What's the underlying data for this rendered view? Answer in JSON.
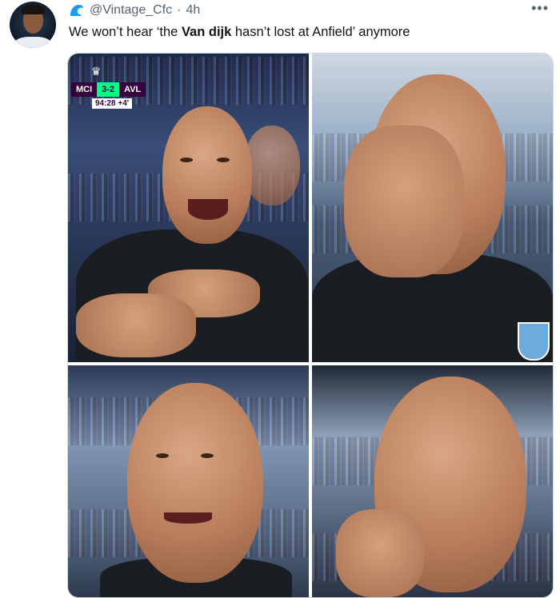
{
  "tweet": {
    "handle": "@Vintage_Cfc",
    "separator": "·",
    "time": "4h",
    "more_icon": "more-icon",
    "text": "We won’t hear ‘the Van dijk hasn’t lost at Anfield’ anymore"
  },
  "scorebug": {
    "home": "MCI",
    "score": "3-2",
    "away": "AVL",
    "clock": "94:28 +4'"
  },
  "colors": {
    "handle_gray": "#536471",
    "text": "#0f1419",
    "pl_purple": "#37003c",
    "pl_green": "#00ff85"
  }
}
